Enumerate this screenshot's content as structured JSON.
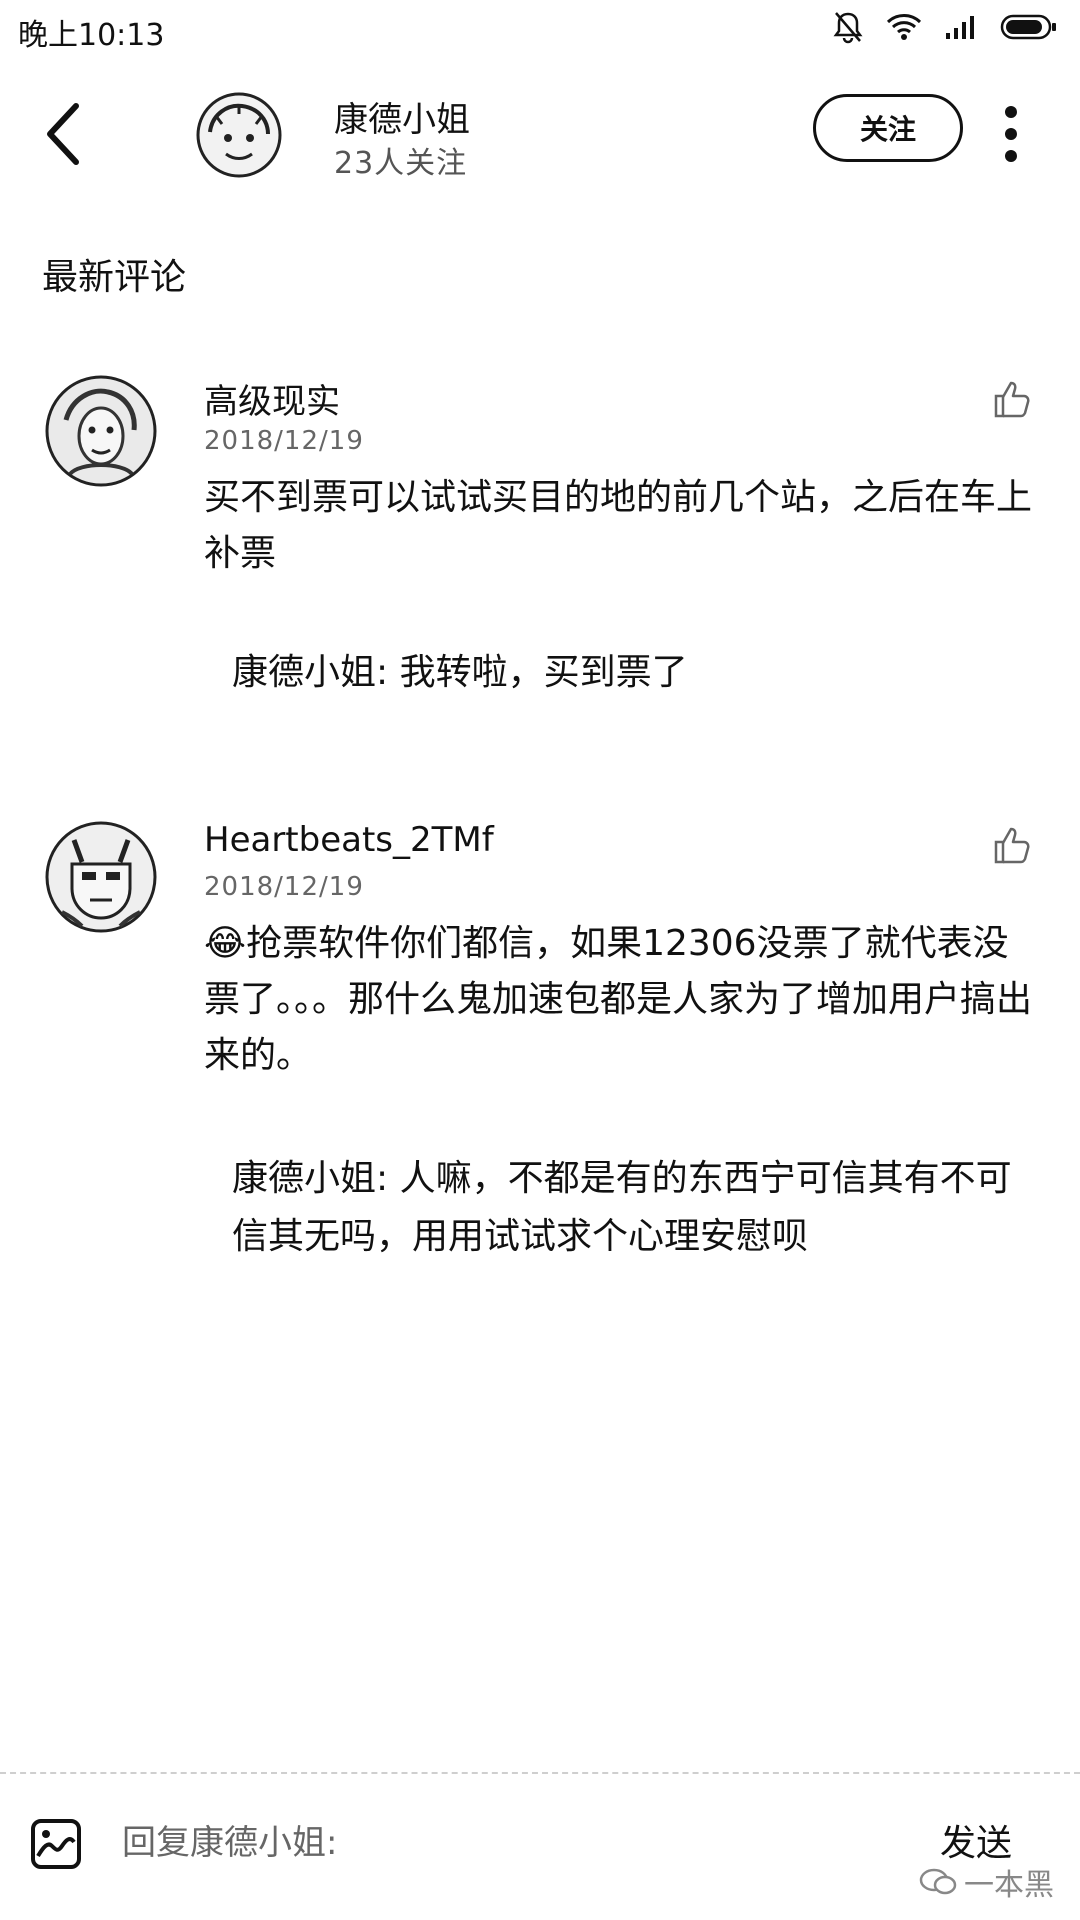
{
  "status_bar": {
    "time": "晚上10:13"
  },
  "header": {
    "user_name": "康德小姐",
    "followers": "23人关注",
    "follow_button": "关注"
  },
  "section_title": "最新评论",
  "comments": [
    {
      "user": "高级现实",
      "date": "2018/12/19",
      "text": "买不到票可以试试买目的地的前几个站，之后在车上补票",
      "reply": "康德小姐: 我转啦，买到票了"
    },
    {
      "user": "Heartbeats_2TMf",
      "date": "2018/12/19",
      "text": "😂抢票软件你们都信，如果12306没票了就代表没票了。。。那什么鬼加速包都是人家为了增加用户搞出来的。",
      "reply": "康德小姐: 人嘛，不都是有的东西宁可信其有不可信其无吗，用用试试求个心理安慰呗"
    }
  ],
  "bottom_bar": {
    "reply_placeholder": "回复康德小姐:",
    "send_label": "发送",
    "watermark": "一本黑"
  }
}
